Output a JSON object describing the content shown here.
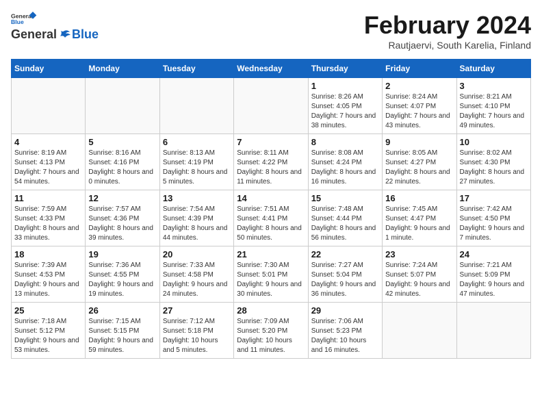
{
  "logo": {
    "line1": "General",
    "line2": "Blue"
  },
  "title": "February 2024",
  "subtitle": "Rautjaervi, South Karelia, Finland",
  "days_of_week": [
    "Sunday",
    "Monday",
    "Tuesday",
    "Wednesday",
    "Thursday",
    "Friday",
    "Saturday"
  ],
  "weeks": [
    [
      {
        "day": "",
        "sunrise": "",
        "sunset": "",
        "daylight": ""
      },
      {
        "day": "",
        "sunrise": "",
        "sunset": "",
        "daylight": ""
      },
      {
        "day": "",
        "sunrise": "",
        "sunset": "",
        "daylight": ""
      },
      {
        "day": "",
        "sunrise": "",
        "sunset": "",
        "daylight": ""
      },
      {
        "day": "1",
        "sunrise": "Sunrise: 8:26 AM",
        "sunset": "Sunset: 4:05 PM",
        "daylight": "Daylight: 7 hours and 38 minutes."
      },
      {
        "day": "2",
        "sunrise": "Sunrise: 8:24 AM",
        "sunset": "Sunset: 4:07 PM",
        "daylight": "Daylight: 7 hours and 43 minutes."
      },
      {
        "day": "3",
        "sunrise": "Sunrise: 8:21 AM",
        "sunset": "Sunset: 4:10 PM",
        "daylight": "Daylight: 7 hours and 49 minutes."
      }
    ],
    [
      {
        "day": "4",
        "sunrise": "Sunrise: 8:19 AM",
        "sunset": "Sunset: 4:13 PM",
        "daylight": "Daylight: 7 hours and 54 minutes."
      },
      {
        "day": "5",
        "sunrise": "Sunrise: 8:16 AM",
        "sunset": "Sunset: 4:16 PM",
        "daylight": "Daylight: 8 hours and 0 minutes."
      },
      {
        "day": "6",
        "sunrise": "Sunrise: 8:13 AM",
        "sunset": "Sunset: 4:19 PM",
        "daylight": "Daylight: 8 hours and 5 minutes."
      },
      {
        "day": "7",
        "sunrise": "Sunrise: 8:11 AM",
        "sunset": "Sunset: 4:22 PM",
        "daylight": "Daylight: 8 hours and 11 minutes."
      },
      {
        "day": "8",
        "sunrise": "Sunrise: 8:08 AM",
        "sunset": "Sunset: 4:24 PM",
        "daylight": "Daylight: 8 hours and 16 minutes."
      },
      {
        "day": "9",
        "sunrise": "Sunrise: 8:05 AM",
        "sunset": "Sunset: 4:27 PM",
        "daylight": "Daylight: 8 hours and 22 minutes."
      },
      {
        "day": "10",
        "sunrise": "Sunrise: 8:02 AM",
        "sunset": "Sunset: 4:30 PM",
        "daylight": "Daylight: 8 hours and 27 minutes."
      }
    ],
    [
      {
        "day": "11",
        "sunrise": "Sunrise: 7:59 AM",
        "sunset": "Sunset: 4:33 PM",
        "daylight": "Daylight: 8 hours and 33 minutes."
      },
      {
        "day": "12",
        "sunrise": "Sunrise: 7:57 AM",
        "sunset": "Sunset: 4:36 PM",
        "daylight": "Daylight: 8 hours and 39 minutes."
      },
      {
        "day": "13",
        "sunrise": "Sunrise: 7:54 AM",
        "sunset": "Sunset: 4:39 PM",
        "daylight": "Daylight: 8 hours and 44 minutes."
      },
      {
        "day": "14",
        "sunrise": "Sunrise: 7:51 AM",
        "sunset": "Sunset: 4:41 PM",
        "daylight": "Daylight: 8 hours and 50 minutes."
      },
      {
        "day": "15",
        "sunrise": "Sunrise: 7:48 AM",
        "sunset": "Sunset: 4:44 PM",
        "daylight": "Daylight: 8 hours and 56 minutes."
      },
      {
        "day": "16",
        "sunrise": "Sunrise: 7:45 AM",
        "sunset": "Sunset: 4:47 PM",
        "daylight": "Daylight: 9 hours and 1 minute."
      },
      {
        "day": "17",
        "sunrise": "Sunrise: 7:42 AM",
        "sunset": "Sunset: 4:50 PM",
        "daylight": "Daylight: 9 hours and 7 minutes."
      }
    ],
    [
      {
        "day": "18",
        "sunrise": "Sunrise: 7:39 AM",
        "sunset": "Sunset: 4:53 PM",
        "daylight": "Daylight: 9 hours and 13 minutes."
      },
      {
        "day": "19",
        "sunrise": "Sunrise: 7:36 AM",
        "sunset": "Sunset: 4:55 PM",
        "daylight": "Daylight: 9 hours and 19 minutes."
      },
      {
        "day": "20",
        "sunrise": "Sunrise: 7:33 AM",
        "sunset": "Sunset: 4:58 PM",
        "daylight": "Daylight: 9 hours and 24 minutes."
      },
      {
        "day": "21",
        "sunrise": "Sunrise: 7:30 AM",
        "sunset": "Sunset: 5:01 PM",
        "daylight": "Daylight: 9 hours and 30 minutes."
      },
      {
        "day": "22",
        "sunrise": "Sunrise: 7:27 AM",
        "sunset": "Sunset: 5:04 PM",
        "daylight": "Daylight: 9 hours and 36 minutes."
      },
      {
        "day": "23",
        "sunrise": "Sunrise: 7:24 AM",
        "sunset": "Sunset: 5:07 PM",
        "daylight": "Daylight: 9 hours and 42 minutes."
      },
      {
        "day": "24",
        "sunrise": "Sunrise: 7:21 AM",
        "sunset": "Sunset: 5:09 PM",
        "daylight": "Daylight: 9 hours and 47 minutes."
      }
    ],
    [
      {
        "day": "25",
        "sunrise": "Sunrise: 7:18 AM",
        "sunset": "Sunset: 5:12 PM",
        "daylight": "Daylight: 9 hours and 53 minutes."
      },
      {
        "day": "26",
        "sunrise": "Sunrise: 7:15 AM",
        "sunset": "Sunset: 5:15 PM",
        "daylight": "Daylight: 9 hours and 59 minutes."
      },
      {
        "day": "27",
        "sunrise": "Sunrise: 7:12 AM",
        "sunset": "Sunset: 5:18 PM",
        "daylight": "Daylight: 10 hours and 5 minutes."
      },
      {
        "day": "28",
        "sunrise": "Sunrise: 7:09 AM",
        "sunset": "Sunset: 5:20 PM",
        "daylight": "Daylight: 10 hours and 11 minutes."
      },
      {
        "day": "29",
        "sunrise": "Sunrise: 7:06 AM",
        "sunset": "Sunset: 5:23 PM",
        "daylight": "Daylight: 10 hours and 16 minutes."
      },
      {
        "day": "",
        "sunrise": "",
        "sunset": "",
        "daylight": ""
      },
      {
        "day": "",
        "sunrise": "",
        "sunset": "",
        "daylight": ""
      }
    ]
  ]
}
